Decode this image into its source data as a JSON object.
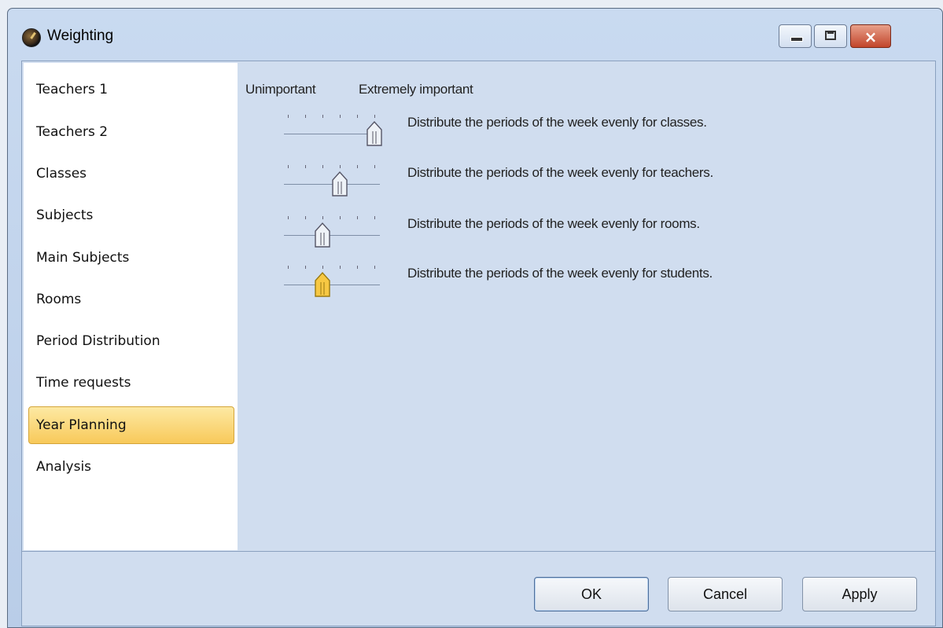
{
  "window": {
    "title": "Weighting"
  },
  "titlebar": {
    "controls": {
      "minimize": "minimize",
      "maximize": "maximize",
      "close": "×"
    }
  },
  "sidebar": {
    "items": [
      {
        "label": "Teachers 1",
        "selected": false
      },
      {
        "label": "Teachers 2",
        "selected": false
      },
      {
        "label": "Classes",
        "selected": false
      },
      {
        "label": "Subjects",
        "selected": false
      },
      {
        "label": "Main Subjects",
        "selected": false
      },
      {
        "label": "Rooms",
        "selected": false
      },
      {
        "label": "Period Distribution",
        "selected": false
      },
      {
        "label": "Time requests",
        "selected": false
      },
      {
        "label": "Year Planning",
        "selected": true
      },
      {
        "label": "Analysis",
        "selected": false
      }
    ]
  },
  "scale": {
    "low_label": "Unimportant",
    "high_label": "Extremely important"
  },
  "sliders": [
    {
      "text": "Distribute the periods of the week evenly for classes.",
      "value": 5,
      "max": 5,
      "focused": false
    },
    {
      "text": "Distribute the periods of the week evenly for teachers.",
      "value": 3,
      "max": 5,
      "focused": false
    },
    {
      "text": "Distribute the periods of the week evenly for rooms.",
      "value": 2,
      "max": 5,
      "focused": false
    },
    {
      "text": "Distribute the periods of the week evenly for students.",
      "value": 2,
      "max": 5,
      "focused": true
    }
  ],
  "footer": {
    "ok_label": "OK",
    "cancel_label": "Cancel",
    "apply_label": "Apply"
  },
  "colors": {
    "selection": "#f8c95a",
    "content_bg": "#d0ddef",
    "thumb_focused": "#f7c843"
  }
}
